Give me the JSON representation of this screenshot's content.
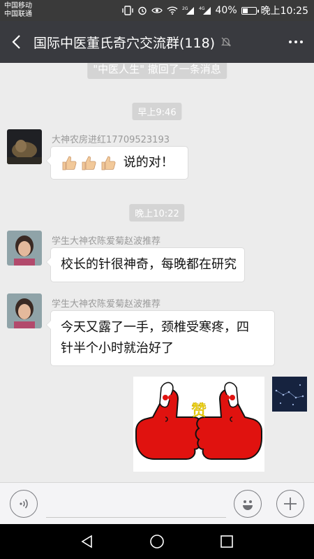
{
  "status_bar": {
    "carrier_1": "中国移动",
    "carrier_2": "中国联通",
    "battery_text": "40%",
    "battery_level": 0.4,
    "time": "晚上10:25",
    "signal_1_label": "2G",
    "signal_2_label": "4G"
  },
  "header": {
    "title": "国际中医董氏奇穴交流群(118)",
    "back_icon": "back-arrow-icon",
    "mute_icon": "mute-bell-icon",
    "more_icon": "more-dots-icon"
  },
  "chat": {
    "recall_notice": "\"中医人生\" 撤回了一条消息",
    "messages": [
      {
        "time": "早上9:46",
        "sender": "大神农房进红17709523193",
        "text": "说的对！",
        "emoji": [
          "thumbs-up",
          "thumbs-up",
          "thumbs-up"
        ]
      },
      {
        "time": "晚上10:22",
        "sender": "学生大神农陈爱菊赵波推荐",
        "text": "校长的针很神奇，每晚都在研究"
      },
      {
        "sender": "学生大神农陈爱菊赵波推荐",
        "text_line_1": "今天又露了一手，颈椎受寒疼，四",
        "text_line_2": "针半个小时就治好了"
      },
      {
        "self": true,
        "image": "thumbs-up-sticker",
        "sticker_text": "赞"
      }
    ]
  },
  "input_bar": {
    "voice_icon": "voice-icon",
    "emoji_icon": "emoji-icon",
    "plus_icon": "plus-icon",
    "placeholder": ""
  },
  "nav_bar": {
    "back": "nav-back-icon",
    "home": "nav-home-icon",
    "recents": "nav-recents-icon"
  },
  "colors": {
    "header_bg": "#393a3f",
    "chat_bg": "#ececec",
    "sticker_red": "#e0120f",
    "sticker_yellow": "#ffe600"
  }
}
